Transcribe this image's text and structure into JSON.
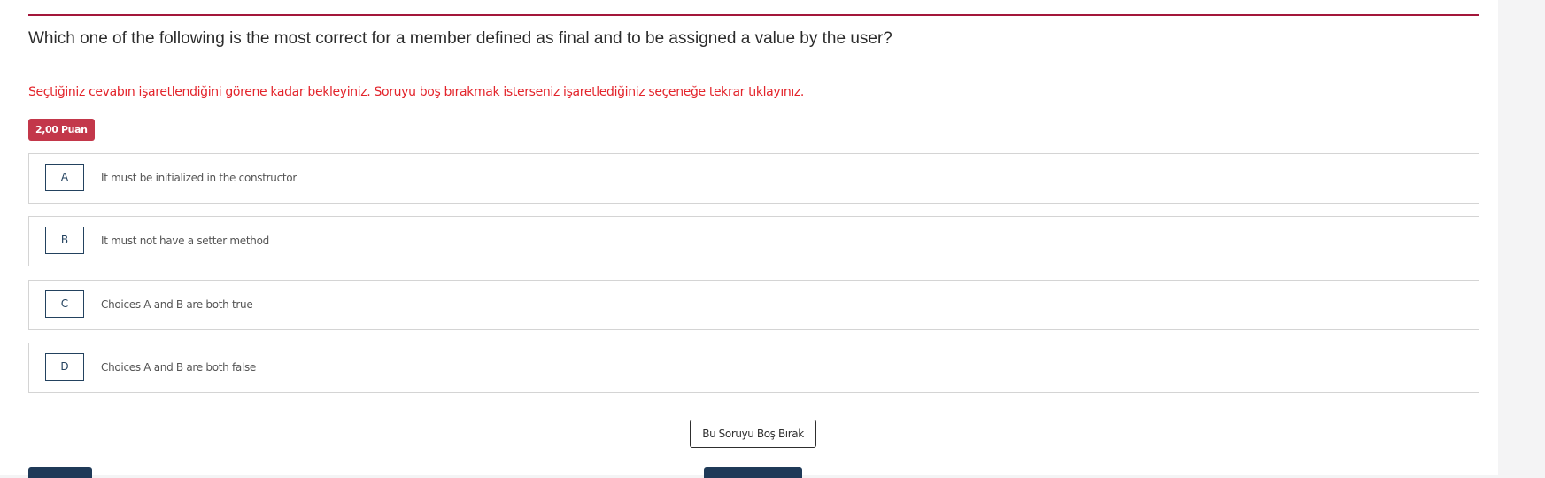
{
  "question": {
    "text": "Which one of the following is the most correct for a member defined as final and to be assigned a value by the user?",
    "notice": "Seçtiğiniz cevabın işaretlendiğini görene kadar bekleyiniz. Soruyu boş bırakmak isterseniz işaretlediğiniz seçeneğe tekrar tıklayınız.",
    "points": "2,00 Puan"
  },
  "choices": [
    {
      "letter": "A",
      "text": "It must be initialized in the constructor"
    },
    {
      "letter": "B",
      "text": "It must not have a setter method"
    },
    {
      "letter": "C",
      "text": "Choices A and B are both true"
    },
    {
      "letter": "D",
      "text": "Choices A and B are both false"
    }
  ],
  "actions": {
    "skip_label": "Bu Soruyu Boş Bırak"
  },
  "colors": {
    "accent_rule": "#a3163a",
    "notice_red": "#e3242b",
    "points_badge": "#c3374a",
    "navy": "#1f3a58"
  }
}
